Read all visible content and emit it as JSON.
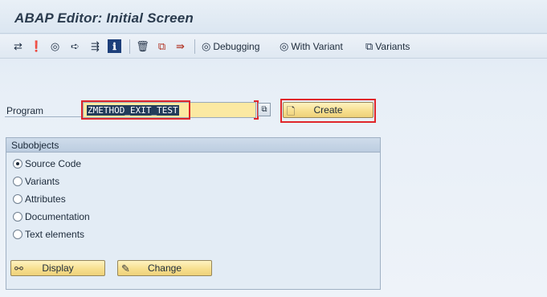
{
  "window": {
    "title": "ABAP Editor: Initial Screen"
  },
  "toolbar": {
    "icons": [
      {
        "name": "other-object-icon",
        "glyph": "⇄"
      },
      {
        "name": "check-icon",
        "glyph": "❗"
      },
      {
        "name": "activate-icon",
        "glyph": "◎"
      },
      {
        "name": "test-execute-icon",
        "glyph": "➪"
      },
      {
        "name": "where-used-icon",
        "glyph": "⇶"
      },
      {
        "name": "info-icon",
        "glyph": "ℹ"
      },
      {
        "name": "delete-icon",
        "glyph": "🗑"
      },
      {
        "name": "copy-icon",
        "glyph": "⧉"
      },
      {
        "name": "rename-icon",
        "glyph": "⇛"
      }
    ],
    "debugging_label": "Debugging",
    "with_variant_label": "With Variant",
    "variants_label": "Variants"
  },
  "program": {
    "label": "Program",
    "value": "ZMETHOD_EXIT_TEST",
    "create_label": "Create"
  },
  "subobjects": {
    "title": "Subobjects",
    "options": [
      {
        "label": "Source Code",
        "checked": true
      },
      {
        "label": "Variants",
        "checked": false
      },
      {
        "label": "Attributes",
        "checked": false
      },
      {
        "label": "Documentation",
        "checked": false
      },
      {
        "label": "Text elements",
        "checked": false
      }
    ],
    "display_label": "Display",
    "change_label": "Change"
  },
  "colors": {
    "input_bg": "#fbe9a2",
    "button_bg": "#f6dd8c",
    "highlight_outline": "#e0262a",
    "title_text": "#2a3b4e"
  }
}
